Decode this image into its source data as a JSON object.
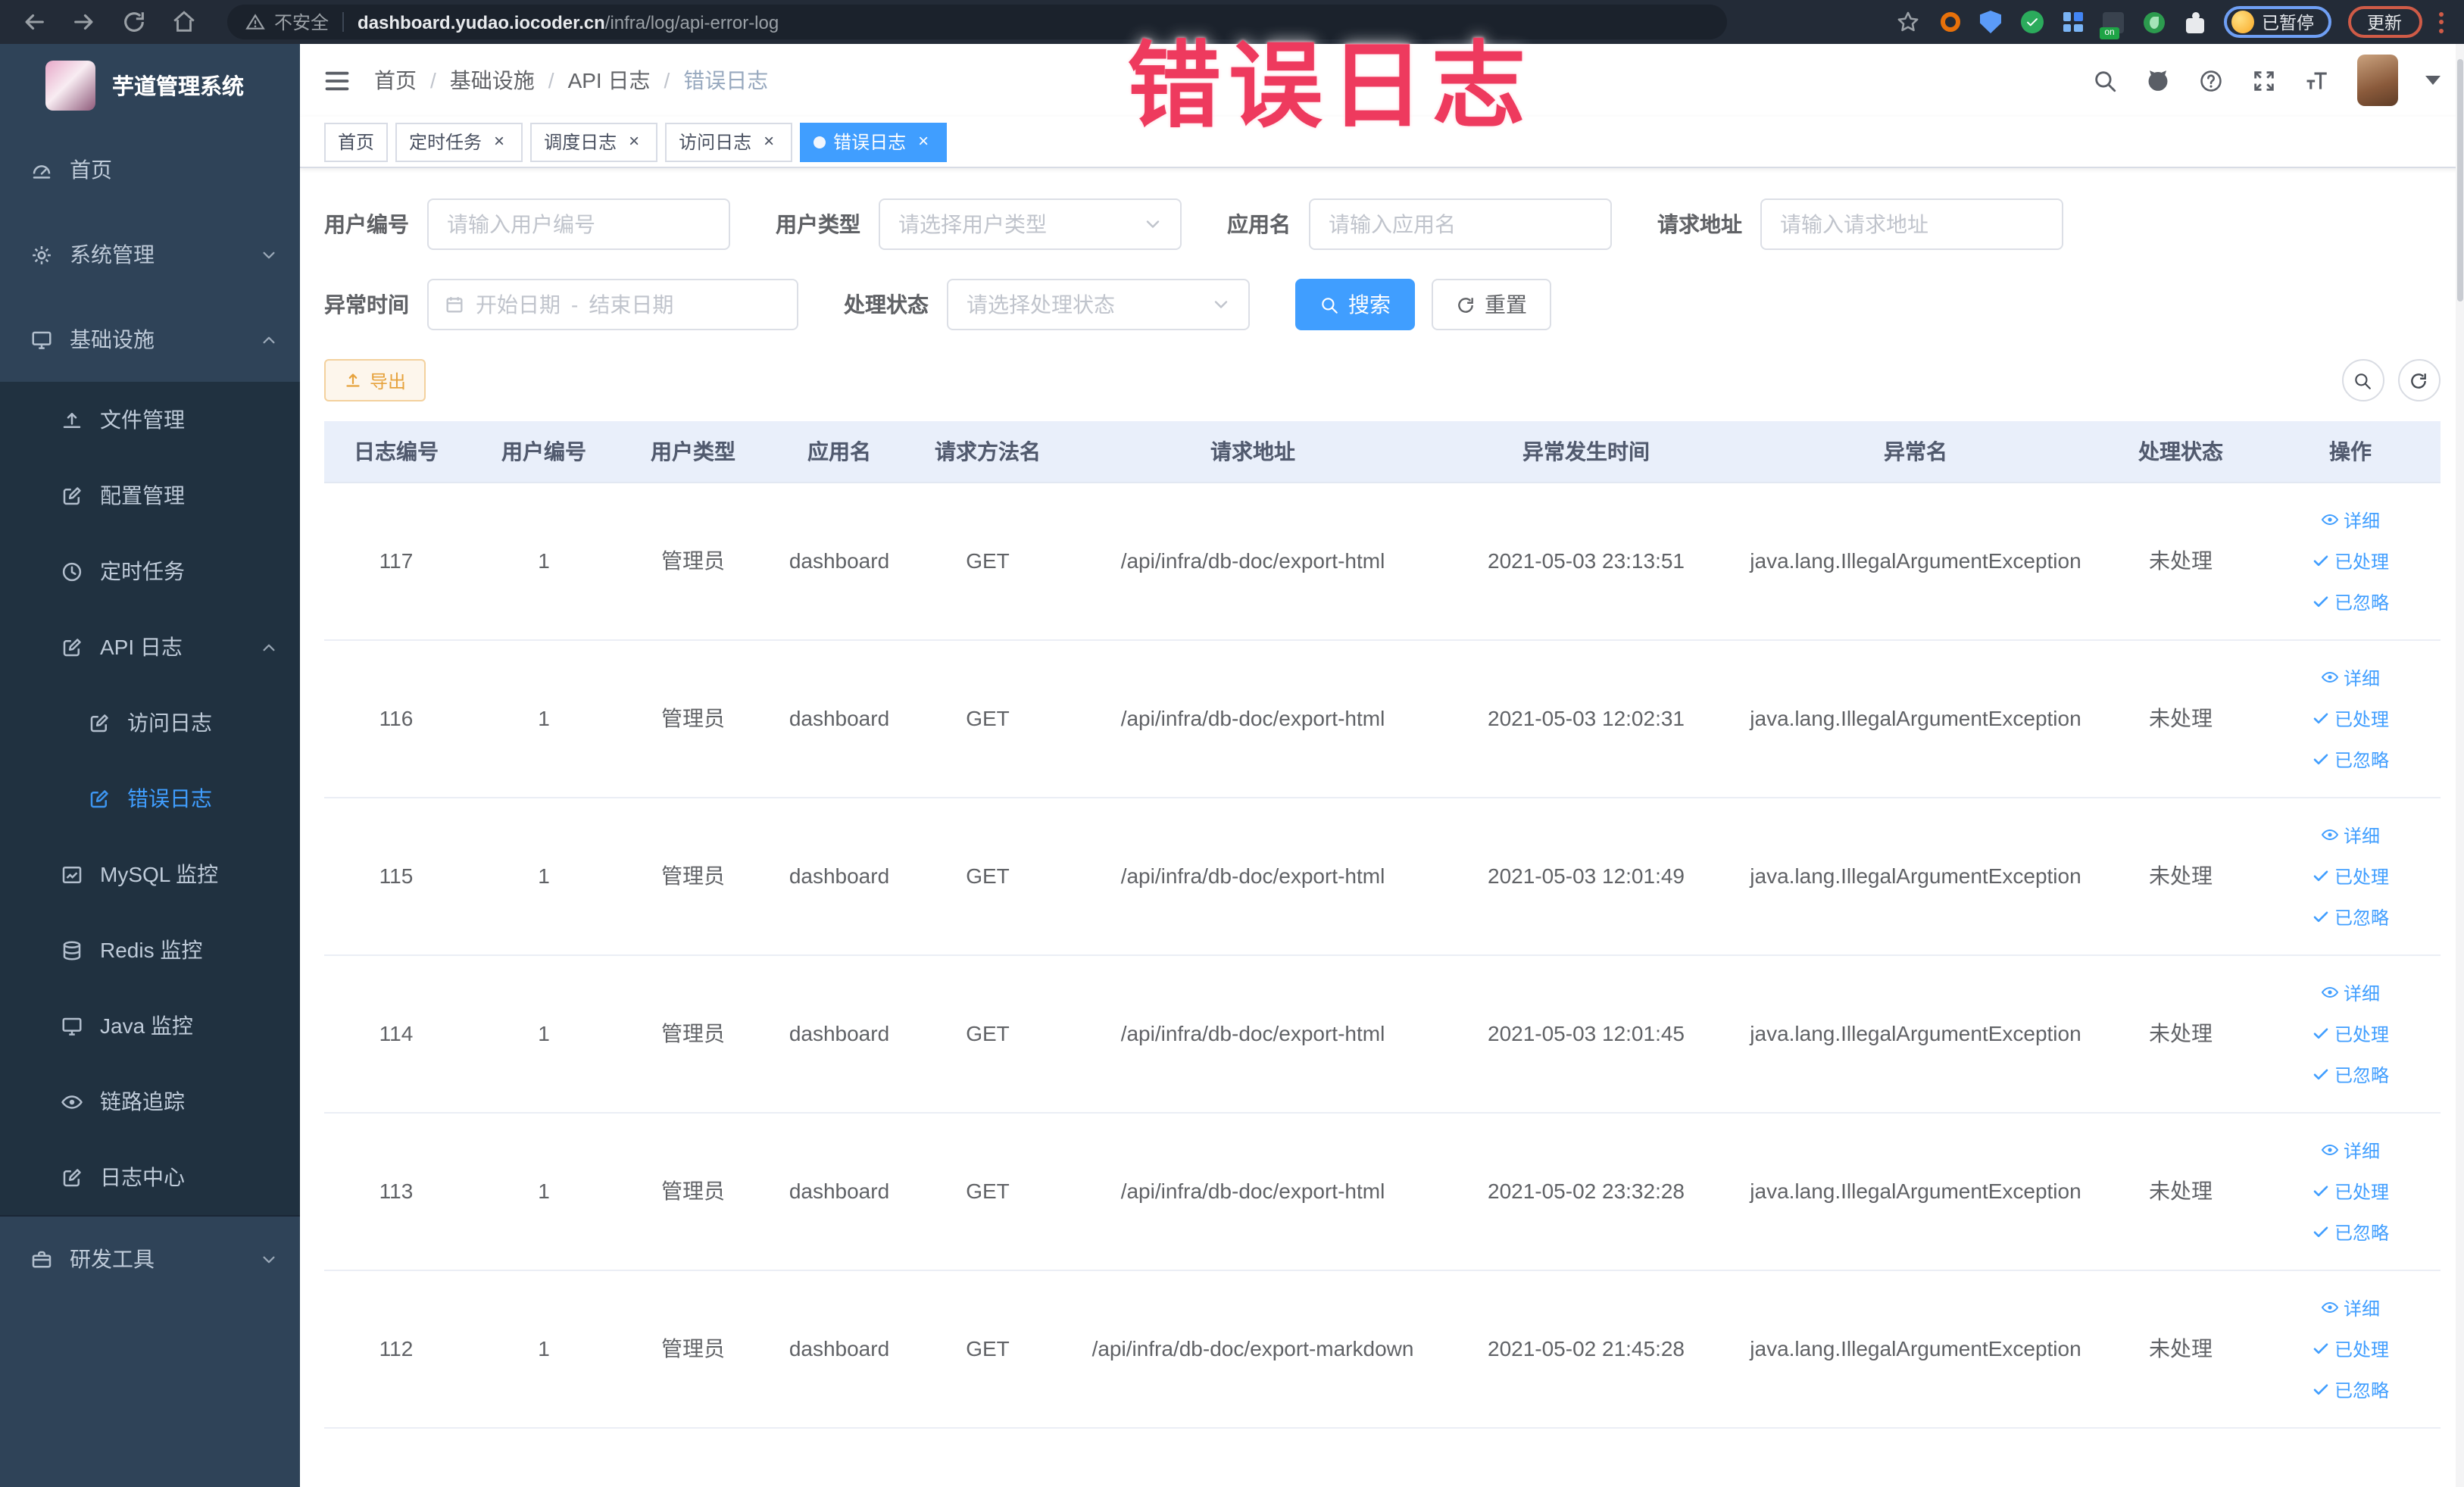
{
  "browser": {
    "security_label": "不安全",
    "url_domain": "dashboard.yudao.iocoder.cn",
    "url_path": "/infra/log/api-error-log",
    "paused_badge": "已暂停",
    "update_label": "更新"
  },
  "annotation": {
    "text": "错误日志"
  },
  "colors": {
    "accent": "#409eff",
    "warning": "#e6a23c",
    "annotation_red": "#ee3a5e",
    "sidebar_bg": "#2f4358",
    "submenu_bg": "#203140"
  },
  "icons": [
    "back-icon",
    "forward-icon",
    "reload-icon",
    "home-icon",
    "warning-icon",
    "star-icon",
    "search-icon",
    "github-icon",
    "help-icon",
    "fullscreen-icon",
    "font-size-icon",
    "hamburger-icon",
    "gauge-icon",
    "gear-icon",
    "monitor-icon",
    "upload-icon",
    "edit-icon",
    "clock-icon",
    "chart-icon",
    "database-icon",
    "eye-icon",
    "briefcase-icon",
    "chevron-down-icon",
    "chevron-up-icon",
    "calendar-icon",
    "refresh-icon",
    "export-icon",
    "check-icon",
    "close-icon"
  ],
  "sidebar": {
    "title": "芋道管理系统",
    "items": [
      {
        "label": "首页"
      },
      {
        "label": "系统管理"
      },
      {
        "label": "基础设施"
      },
      {
        "label": "文件管理"
      },
      {
        "label": "配置管理"
      },
      {
        "label": "定时任务"
      },
      {
        "label": "API 日志"
      },
      {
        "label": "访问日志"
      },
      {
        "label": "错误日志"
      },
      {
        "label": "MySQL 监控"
      },
      {
        "label": "Redis 监控"
      },
      {
        "label": "Java 监控"
      },
      {
        "label": "链路追踪"
      },
      {
        "label": "日志中心"
      },
      {
        "label": "研发工具"
      }
    ]
  },
  "breadcrumb": {
    "separator": "/",
    "items": [
      "首页",
      "基础设施",
      "API 日志",
      "错误日志"
    ]
  },
  "tabs": [
    {
      "label": "首页"
    },
    {
      "label": "定时任务"
    },
    {
      "label": "调度日志"
    },
    {
      "label": "访问日志"
    },
    {
      "label": "错误日志"
    }
  ],
  "filters": {
    "user_id": {
      "label": "用户编号",
      "placeholder": "请输入用户编号"
    },
    "user_type": {
      "label": "用户类型",
      "placeholder": "请选择用户类型"
    },
    "app_name": {
      "label": "应用名",
      "placeholder": "请输入应用名"
    },
    "request_url": {
      "label": "请求地址",
      "placeholder": "请输入请求地址"
    },
    "exception_time": {
      "label": "异常时间",
      "start_placeholder": "开始日期",
      "separator": "-",
      "end_placeholder": "结束日期"
    },
    "process_status": {
      "label": "处理状态",
      "placeholder": "请选择处理状态"
    },
    "search_button": "搜索",
    "reset_button": "重置"
  },
  "toolbar": {
    "export_button": "导出"
  },
  "table": {
    "columns": [
      "日志编号",
      "用户编号",
      "用户类型",
      "应用名",
      "请求方法名",
      "请求地址",
      "异常发生时间",
      "异常名",
      "处理状态",
      "操作"
    ],
    "action_labels": [
      "详细",
      "已处理",
      "已忽略"
    ],
    "rows": [
      {
        "id": "117",
        "user_id": "1",
        "user_type": "管理员",
        "app": "dashboard",
        "method": "GET",
        "url": "/api/infra/db-doc/export-html",
        "time": "2021-05-03 23:13:51",
        "exception": "java.lang.IllegalArgumentException",
        "status": "未处理"
      },
      {
        "id": "116",
        "user_id": "1",
        "user_type": "管理员",
        "app": "dashboard",
        "method": "GET",
        "url": "/api/infra/db-doc/export-html",
        "time": "2021-05-03 12:02:31",
        "exception": "java.lang.IllegalArgumentException",
        "status": "未处理"
      },
      {
        "id": "115",
        "user_id": "1",
        "user_type": "管理员",
        "app": "dashboard",
        "method": "GET",
        "url": "/api/infra/db-doc/export-html",
        "time": "2021-05-03 12:01:49",
        "exception": "java.lang.IllegalArgumentException",
        "status": "未处理"
      },
      {
        "id": "114",
        "user_id": "1",
        "user_type": "管理员",
        "app": "dashboard",
        "method": "GET",
        "url": "/api/infra/db-doc/export-html",
        "time": "2021-05-03 12:01:45",
        "exception": "java.lang.IllegalArgumentException",
        "status": "未处理"
      },
      {
        "id": "113",
        "user_id": "1",
        "user_type": "管理员",
        "app": "dashboard",
        "method": "GET",
        "url": "/api/infra/db-doc/export-html",
        "time": "2021-05-02 23:32:28",
        "exception": "java.lang.IllegalArgumentException",
        "status": "未处理"
      },
      {
        "id": "112",
        "user_id": "1",
        "user_type": "管理员",
        "app": "dashboard",
        "method": "GET",
        "url": "/api/infra/db-doc/export-markdown",
        "time": "2021-05-02 21:45:28",
        "exception": "java.lang.IllegalArgumentException",
        "status": "未处理"
      }
    ]
  }
}
